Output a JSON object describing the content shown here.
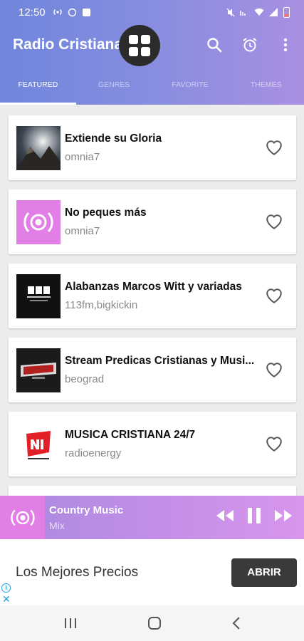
{
  "status_bar": {
    "time": "12:50"
  },
  "app": {
    "title": "Radio Cristiana",
    "tabs": [
      {
        "label": "FEATURED",
        "active": true
      },
      {
        "label": "GENRES",
        "active": false
      },
      {
        "label": "FAVORITE",
        "active": false
      },
      {
        "label": "THEMES",
        "active": false
      }
    ]
  },
  "stations": [
    {
      "name": "Extiende su Gloria",
      "source": "omnia7",
      "icon": "photo-thumb"
    },
    {
      "name": "No peques más",
      "source": "omnia7",
      "icon": "radio-broadcast-icon"
    },
    {
      "name": "Alabanzas  Marcos Witt y variadas",
      "source": "113fm,bigkickin",
      "icon": "113-radio-logo"
    },
    {
      "name": "Stream Predicas Cristianas y Musi...",
      "source": "beograd",
      "icon": "rock-radio-logo"
    },
    {
      "name": "MUSICA CRISTIANA 24/7",
      "source": "radioenergy",
      "icon": "nrj-logo"
    }
  ],
  "player": {
    "title": "Country Music",
    "subtitle": "Mix"
  },
  "ad": {
    "text": "Los Mejores Precios",
    "button": "ABRIR"
  },
  "colors": {
    "accent_start": "#6f86dc",
    "accent_end": "#a98fe2",
    "player_pink": "#e17fe6"
  }
}
